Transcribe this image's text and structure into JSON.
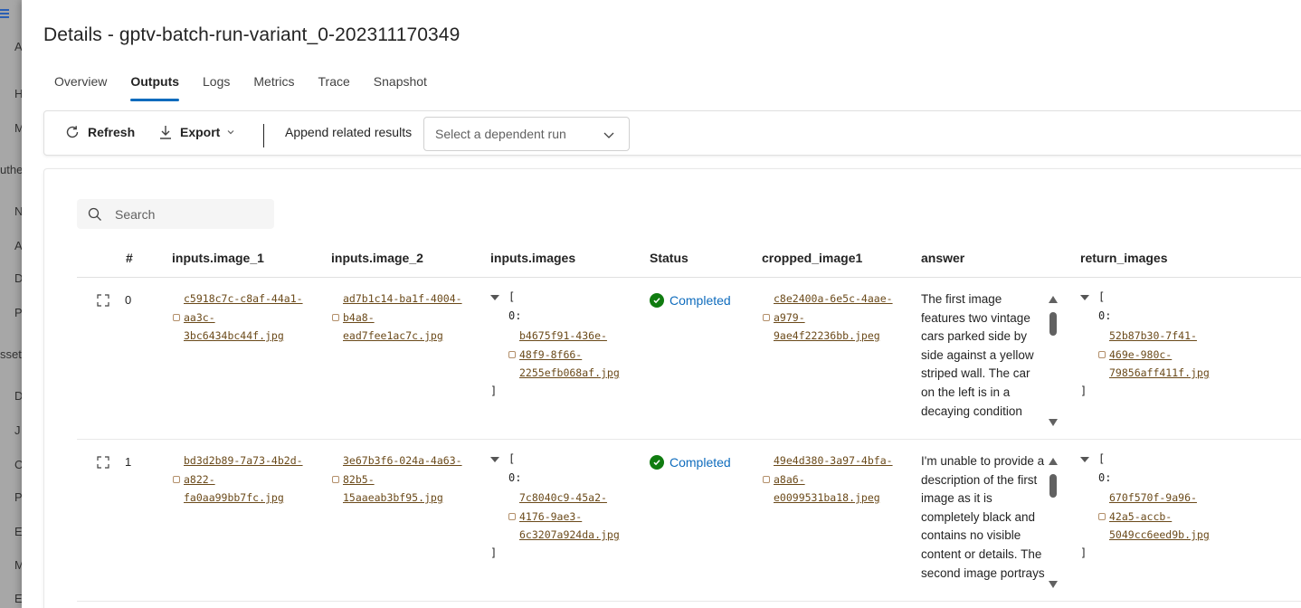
{
  "background_nav": {
    "items": [
      "A",
      "H",
      "M",
      "uthe",
      "N",
      "A",
      "D",
      "P",
      "sset",
      "D",
      "J",
      "C",
      "P",
      "E",
      "M",
      "E"
    ]
  },
  "title": "Details - gptv-batch-run-variant_0-202311170349",
  "tabs": [
    {
      "label": "Overview",
      "active": false
    },
    {
      "label": "Outputs",
      "active": true
    },
    {
      "label": "Logs",
      "active": false
    },
    {
      "label": "Metrics",
      "active": false
    },
    {
      "label": "Trace",
      "active": false
    },
    {
      "label": "Snapshot",
      "active": false
    }
  ],
  "toolbar": {
    "refresh_label": "Refresh",
    "export_label": "Export",
    "append_label": "Append related results",
    "dependent_run_placeholder": "Select a dependent run"
  },
  "search": {
    "placeholder": "Search"
  },
  "table": {
    "columns": [
      "#",
      "inputs.image_1",
      "inputs.image_2",
      "inputs.images",
      "Status",
      "cropped_image1",
      "answer",
      "return_images"
    ],
    "rows": [
      {
        "index": "0",
        "image_1": [
          "c5918c7c-c8af-44a1-",
          "aa3c-",
          "3bc6434bc44f.jpg"
        ],
        "image_2": [
          "ad7b1c14-ba1f-4004-",
          "b4a8-",
          "ead7fee1ac7c.jpg"
        ],
        "images_open": "[",
        "images_key": "0:",
        "images": [
          "b4675f91-436e-",
          "48f9-8f66-",
          "2255efb068af.jpg"
        ],
        "images_close": "]",
        "status": "Completed",
        "cropped_image1": [
          "c8e2400a-6e5c-4aae-",
          "a979-",
          "9ae4f22236bb.jpeg"
        ],
        "answer": "The first image features two vintage cars parked side by side against a yellow striped wall. The car on the left is in a decaying condition with its paint peeling",
        "return_open": "[",
        "return_key": "0:",
        "return_images": [
          "52b87b30-7f41-",
          "469e-980c-",
          "79856aff411f.jpg"
        ],
        "return_close": "]"
      },
      {
        "index": "1",
        "image_1": [
          "bd3d2b89-7a73-4b2d-",
          "a822-",
          "fa0aa99bb7fc.jpg"
        ],
        "image_2": [
          "3e67b3f6-024a-4a63-",
          "82b5-",
          "15aaeab3bf95.jpg"
        ],
        "images_open": "[",
        "images_key": "0:",
        "images": [
          "7c8040c9-45a2-",
          "4176-9ae3-",
          "6c3207a924da.jpg"
        ],
        "images_close": "]",
        "status": "Completed",
        "cropped_image1": [
          "49e4d380-3a97-4bfa-",
          "a8a6-",
          "e0099531ba18.jpeg"
        ],
        "answer": "I'm unable to provide a description of the first image as it is completely black and contains no visible content or details. The second image portrays two lovely",
        "return_open": "[",
        "return_key": "0:",
        "return_images": [
          "670f570f-9a96-",
          "42a5-accb-",
          "5049cc6eed9b.jpg"
        ],
        "return_close": "]"
      }
    ]
  },
  "colors": {
    "accent": "#0f6cbd",
    "success": "#107c10",
    "link": "#6b4a1a"
  }
}
